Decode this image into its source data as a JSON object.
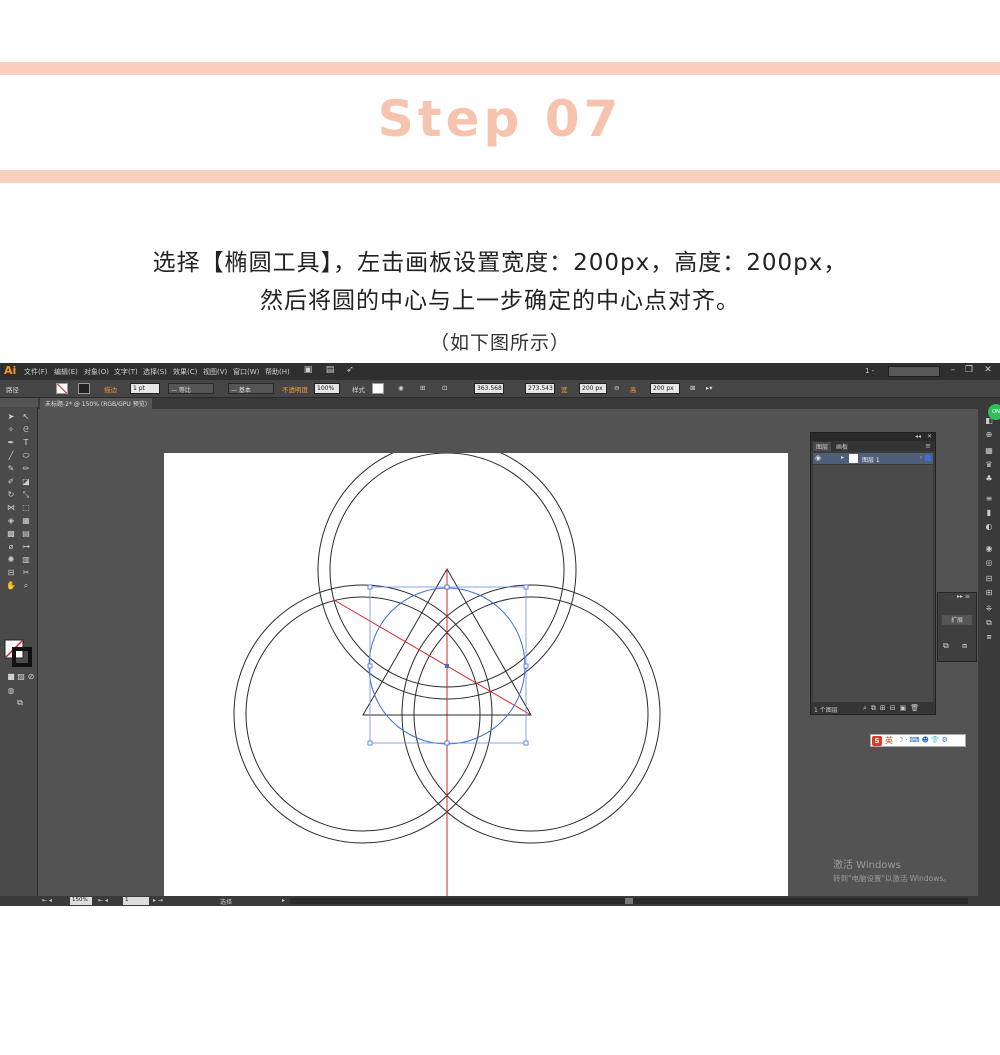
{
  "header": {
    "step_title": "Step 07",
    "instruction_line1": "选择【椭圆工具】，左击画板设置宽度：200px，高度：200px，",
    "instruction_line2": "然后将圆的中心与上一步确定的中心点对齐。",
    "caption": "（如下图所示）"
  },
  "app": {
    "logo": "Ai",
    "menu": [
      "文件(F)",
      "编辑(E)",
      "对象(O)",
      "文字(T)",
      "选择(S)",
      "效果(C)",
      "视图(V)",
      "窗口(W)",
      "帮助(H)"
    ],
    "workspace_label": "1 -",
    "control_bar": {
      "object_type": "路径",
      "stroke_label": "描边",
      "stroke_weight": "1 pt",
      "profile_label": "等比",
      "brush_label": "基本",
      "opacity_label": "不透明度",
      "opacity_value": "100%",
      "style_label": "样式",
      "x_value": "363.568",
      "y_value": "273.543",
      "w_label": "宽",
      "w_value": "200 px",
      "h_label": "高",
      "h_value": "200 px"
    },
    "document_tab": "未标题-2* @ 150% (RGB/GPU 预览)",
    "layers_panel": {
      "tab_layers": "图层",
      "tab_artboards": "画板",
      "layer_name": "图层 1",
      "footer_count": "1 个图层"
    },
    "expand_panel_label": "扩展",
    "ime": {
      "logo": "S",
      "lang": "英",
      "icons": "☽·⌨☻👕⚙"
    },
    "watermark": {
      "title": "激活 Windows",
      "subtitle": "转到\"电脑设置\"以激活 Windows。"
    },
    "status": {
      "zoom": "150%",
      "page": "1",
      "tool": "选择"
    },
    "colors": {
      "guide_red": "#d9232d",
      "selection_blue": "#3f6fd8",
      "accent_orange": "#f39a3b"
    }
  }
}
